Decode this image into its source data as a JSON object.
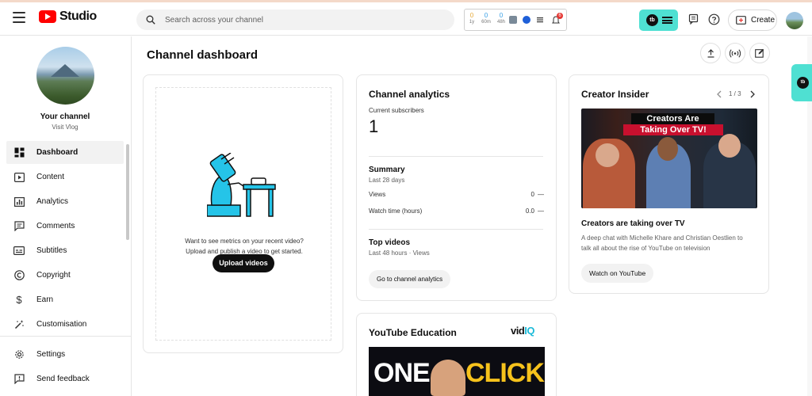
{
  "header": {
    "logo_text": "Studio",
    "search_placeholder": "Search across your channel",
    "ext": {
      "stat1_value": "0",
      "stat1_label": "1y",
      "stat2_value": "0",
      "stat2_label": "60m",
      "stat3_value": "0",
      "stat3_label": "48h",
      "notification_count": "6"
    },
    "create_label": "Create"
  },
  "sidebar": {
    "channel_name": "Your channel",
    "channel_handle": "Visit Vlog",
    "items": [
      {
        "label": "Dashboard",
        "icon": "dashboard-icon"
      },
      {
        "label": "Content",
        "icon": "content-icon"
      },
      {
        "label": "Analytics",
        "icon": "analytics-icon"
      },
      {
        "label": "Comments",
        "icon": "comments-icon"
      },
      {
        "label": "Subtitles",
        "icon": "subtitles-icon"
      },
      {
        "label": "Copyright",
        "icon": "copyright-icon"
      },
      {
        "label": "Earn",
        "icon": "earn-icon"
      },
      {
        "label": "Customisation",
        "icon": "customisation-icon"
      }
    ],
    "bottom_items": [
      {
        "label": "Settings",
        "icon": "gear-icon"
      },
      {
        "label": "Send feedback",
        "icon": "feedback-icon"
      }
    ]
  },
  "main": {
    "page_title": "Channel dashboard",
    "upload_card": {
      "line1": "Want to see metrics on your recent video?",
      "line2": "Upload and publish a video to get started.",
      "button": "Upload videos"
    },
    "analytics_card": {
      "title": "Channel analytics",
      "subscribers_label": "Current subscribers",
      "subscribers_value": "1",
      "summary_title": "Summary",
      "summary_period": "Last 28 days",
      "rows": [
        {
          "label": "Views",
          "value": "0",
          "trend": "—"
        },
        {
          "label": "Watch time (hours)",
          "value": "0.0",
          "trend": "—"
        }
      ],
      "top_videos_title": "Top videos",
      "top_videos_period": "Last 48 hours · Views",
      "button": "Go to channel analytics"
    },
    "insider_card": {
      "title": "Creator Insider",
      "pager": "1 / 3",
      "thumb_line1": "Creators Are",
      "thumb_line2": "Taking Over TV!",
      "video_title": "Creators are taking over TV",
      "description_line1": "A deep chat with Michelle Khare and Christian Oestlien to",
      "description_line2": "talk all about the rise of YouTube on television",
      "button": "Watch on YouTube"
    },
    "education_card": {
      "title": "YouTube Education",
      "brand_part1": "vid",
      "brand_part2": "IQ",
      "thumb_word1": "ONE",
      "thumb_word2": "CLICK"
    }
  },
  "colors": {
    "brand_red": "#ff0000",
    "extension_teal": "#4fe0d2",
    "vidiq_blue": "#1bbad8",
    "thumb_yellow": "#f6c21c"
  }
}
